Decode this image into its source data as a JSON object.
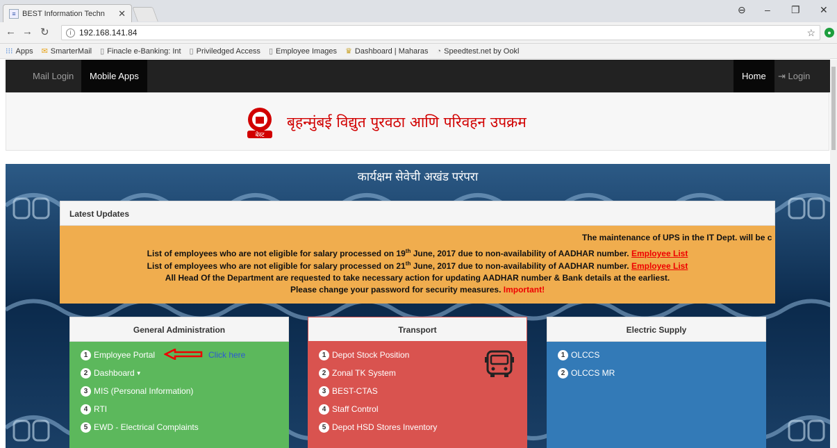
{
  "browser": {
    "tab_title": "BEST Information Techn",
    "url": "192.168.141.84",
    "bookmarks": [
      {
        "label": "Apps",
        "icon": "apps-grid-icon"
      },
      {
        "label": "SmarterMail",
        "icon": "mail-icon"
      },
      {
        "label": "Finacle e-Banking: Int",
        "icon": "page-icon"
      },
      {
        "label": "Priviledged Access",
        "icon": "page-icon"
      },
      {
        "label": "Employee Images",
        "icon": "page-icon"
      },
      {
        "label": "Dashboard | Maharas",
        "icon": "emblem-icon"
      },
      {
        "label": "Speedtest.net by Ookl",
        "icon": "speedometer-icon"
      }
    ]
  },
  "nav": {
    "mail_login": "Mail Login",
    "mobile_apps": "Mobile Apps",
    "home": "Home",
    "login": "Login"
  },
  "banner": {
    "title": "बृहन्मुंबई विद्युत पुरवठा आणि परिवहन उपक्रम"
  },
  "hero": {
    "title": "कार्यक्षम सेवेची अखंड परंपरा"
  },
  "updates": {
    "heading": "Latest Updates",
    "marquee": "The maintenance of UPS in the IT Dept. will be c",
    "line1_pre": "List of employees who are not eligible for salary processed on 19",
    "line1_sup": "th",
    "line1_post": " June, 2017 due to non-availability of AADHAR number. ",
    "line1_link": "Employee List",
    "line2_pre": "List of employees who are not eligible for salary processed on 21",
    "line2_sup": "th",
    "line2_post": " June, 2017 due to non-availability of AADHAR number. ",
    "line2_link": "Employee List",
    "line3": "All Head Of the Department are requested to take necessary action for updating AADHAR number & Bank details at the earliest.",
    "line4_pre": "Please change your password for security measures. ",
    "line4_important": "Important!"
  },
  "panels": {
    "general": {
      "title": "General Administration",
      "items": [
        "Employee Portal",
        "Dashboard",
        "MIS (Personal Information)",
        "RTI",
        "EWD - Electrical Complaints"
      ],
      "click_here": "Click here"
    },
    "transport": {
      "title": "Transport",
      "items": [
        "Depot Stock Position",
        "Zonal TK System",
        "BEST-CTAS",
        "Staff Control",
        "Depot HSD Stores Inventory"
      ]
    },
    "electric": {
      "title": "Electric Supply",
      "items": [
        "OLCCS",
        "OLCCS MR"
      ]
    }
  },
  "colors": {
    "navbar": "#222222",
    "updates_bg": "#f0ad4e",
    "general": "#5cb85c",
    "transport": "#d9534f",
    "electric": "#337ab7",
    "banner_title": "#d10000"
  }
}
